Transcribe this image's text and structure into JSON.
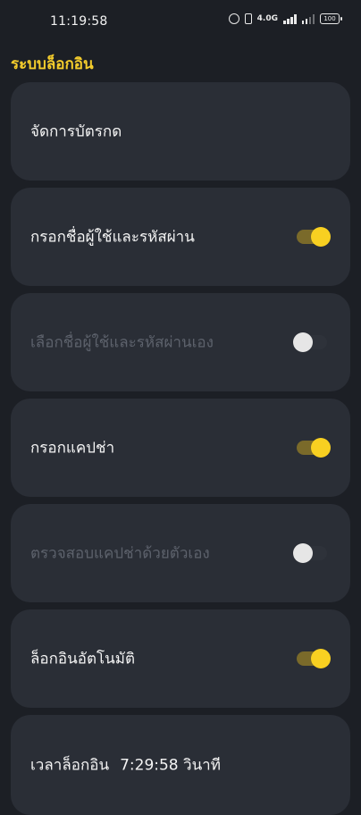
{
  "status_bar": {
    "time": "11:19:58",
    "network_label": "4.0G",
    "battery": "100"
  },
  "page": {
    "title": "ระบบล็อกอิน"
  },
  "settings": {
    "manage_card": {
      "label": "จัดการบัตรกด"
    },
    "fill_credentials": {
      "label": "กรอกชื่อผู้ใช้และรหัสผ่าน",
      "enabled": true,
      "toggle_on": true
    },
    "choose_credentials": {
      "label": "เลือกชื่อผู้ใช้และรหัสผ่านเอง",
      "enabled": false,
      "toggle_on": false
    },
    "fill_captcha": {
      "label": "กรอกแคปช่า",
      "enabled": true,
      "toggle_on": true
    },
    "verify_captcha": {
      "label": "ตรวจสอบแคปช่าด้วยตัวเอง",
      "enabled": false,
      "toggle_on": false
    },
    "auto_login": {
      "label": "ล็อกอินอัตโนมัติ",
      "enabled": true,
      "toggle_on": true
    },
    "login_time": {
      "label": "เวลาล็อกอิน",
      "value": "7:29:58 วินาที"
    }
  },
  "colors": {
    "accent": "#f8d021",
    "background": "#1c1f25",
    "card": "#2a2e36",
    "disabled_text": "#5d626c"
  }
}
